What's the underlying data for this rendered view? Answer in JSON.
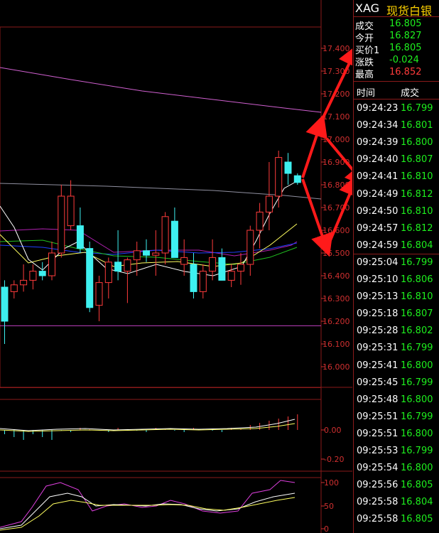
{
  "symbol": "XAG",
  "name": "现货白银",
  "quote": [
    {
      "label": "成交",
      "value": "16.805",
      "color": "#1ef01e"
    },
    {
      "label": "今开",
      "value": "16.827",
      "color": "#1ef01e"
    },
    {
      "label": "买价1",
      "value": "16.805",
      "color": "#1ef01e"
    },
    {
      "label": "涨跌",
      "value": "-0.024",
      "color": "#1ef01e"
    },
    {
      "label": "最高",
      "value": "16.852",
      "color": "#ff3b3b"
    }
  ],
  "ticks_header": {
    "time": "时间",
    "price": "成交"
  },
  "ticks": [
    {
      "time": "09:24:23",
      "price": "16.799"
    },
    {
      "time": "09:24:34",
      "price": "16.801"
    },
    {
      "time": "09:24:39",
      "price": "16.800"
    },
    {
      "time": "09:24:40",
      "price": "16.807"
    },
    {
      "time": "09:24:41",
      "price": "16.810"
    },
    {
      "time": "09:24:49",
      "price": "16.812"
    },
    {
      "time": "09:24:50",
      "price": "16.810"
    },
    {
      "time": "09:24:57",
      "price": "16.812"
    },
    {
      "time": "09:24:59",
      "price": "16.804"
    },
    {
      "time": "09:25:04",
      "price": "16.799"
    },
    {
      "time": "09:25:10",
      "price": "16.806"
    },
    {
      "time": "09:25:13",
      "price": "16.810"
    },
    {
      "time": "09:25:18",
      "price": "16.807"
    },
    {
      "time": "09:25:28",
      "price": "16.802"
    },
    {
      "time": "09:25:31",
      "price": "16.799"
    },
    {
      "time": "09:25:41",
      "price": "16.800"
    },
    {
      "time": "09:25:45",
      "price": "16.799"
    },
    {
      "time": "09:25:48",
      "price": "16.800"
    },
    {
      "time": "09:25:51",
      "price": "16.799"
    },
    {
      "time": "09:25:51",
      "price": "16.800"
    },
    {
      "time": "09:25:53",
      "price": "16.799"
    },
    {
      "time": "09:25:54",
      "price": "16.800"
    },
    {
      "time": "09:25:56",
      "price": "16.805"
    },
    {
      "time": "09:25:58",
      "price": "16.804"
    },
    {
      "time": "09:25:58",
      "price": "16.805"
    }
  ],
  "chart_data": [
    {
      "type": "candlestick",
      "ylim": [
        15.9,
        17.5
      ],
      "y_ticks": [
        "17.400",
        "17.300",
        "17.200",
        "17.100",
        "17.000",
        "16.900",
        "16.800",
        "16.700",
        "16.600",
        "16.500",
        "16.400",
        "16.300",
        "16.200",
        "16.100",
        "16.000"
      ],
      "candles": [
        {
          "o": 16.2,
          "h": 16.38,
          "l": 16.1,
          "c": 16.35,
          "up": false
        },
        {
          "o": 16.33,
          "h": 16.38,
          "l": 16.3,
          "c": 16.36,
          "up": true
        },
        {
          "o": 16.36,
          "h": 16.45,
          "l": 16.33,
          "c": 16.38,
          "up": true
        },
        {
          "o": 16.38,
          "h": 16.45,
          "l": 16.34,
          "c": 16.42,
          "up": true
        },
        {
          "o": 16.42,
          "h": 16.46,
          "l": 16.38,
          "c": 16.4,
          "up": false
        },
        {
          "o": 16.4,
          "h": 16.55,
          "l": 16.38,
          "c": 16.5,
          "up": true
        },
        {
          "o": 16.5,
          "h": 16.8,
          "l": 16.48,
          "c": 16.75,
          "up": true
        },
        {
          "o": 16.75,
          "h": 16.82,
          "l": 16.6,
          "c": 16.62,
          "up": true
        },
        {
          "o": 16.62,
          "h": 16.7,
          "l": 16.5,
          "c": 16.52,
          "up": false
        },
        {
          "o": 16.52,
          "h": 16.55,
          "l": 16.24,
          "c": 16.26,
          "up": false
        },
        {
          "o": 16.27,
          "h": 16.4,
          "l": 16.2,
          "c": 16.37,
          "up": true
        },
        {
          "o": 16.37,
          "h": 16.48,
          "l": 16.3,
          "c": 16.46,
          "up": true
        },
        {
          "o": 16.46,
          "h": 16.6,
          "l": 16.38,
          "c": 16.42,
          "up": false
        },
        {
          "o": 16.42,
          "h": 16.48,
          "l": 16.28,
          "c": 16.47,
          "up": true
        },
        {
          "o": 16.47,
          "h": 16.55,
          "l": 16.4,
          "c": 16.51,
          "up": true
        },
        {
          "o": 16.51,
          "h": 16.56,
          "l": 16.46,
          "c": 16.49,
          "up": false
        },
        {
          "o": 16.49,
          "h": 16.6,
          "l": 16.4,
          "c": 16.5,
          "up": true
        },
        {
          "o": 16.5,
          "h": 16.68,
          "l": 16.45,
          "c": 16.66,
          "up": true
        },
        {
          "o": 16.64,
          "h": 16.7,
          "l": 16.48,
          "c": 16.48,
          "up": false
        },
        {
          "o": 16.48,
          "h": 16.56,
          "l": 16.4,
          "c": 16.45,
          "up": true
        },
        {
          "o": 16.45,
          "h": 16.5,
          "l": 16.3,
          "c": 16.33,
          "up": false
        },
        {
          "o": 16.33,
          "h": 16.45,
          "l": 16.3,
          "c": 16.42,
          "up": true
        },
        {
          "o": 16.42,
          "h": 16.56,
          "l": 16.38,
          "c": 16.48,
          "up": true
        },
        {
          "o": 16.48,
          "h": 16.52,
          "l": 16.38,
          "c": 16.38,
          "up": false
        },
        {
          "o": 16.38,
          "h": 16.45,
          "l": 16.35,
          "c": 16.42,
          "up": true
        },
        {
          "o": 16.42,
          "h": 16.5,
          "l": 16.36,
          "c": 16.45,
          "up": true
        },
        {
          "o": 16.45,
          "h": 16.62,
          "l": 16.4,
          "c": 16.6,
          "up": true
        },
        {
          "o": 16.6,
          "h": 16.72,
          "l": 16.52,
          "c": 16.68,
          "up": true
        },
        {
          "o": 16.68,
          "h": 16.9,
          "l": 16.6,
          "c": 16.75,
          "up": true
        },
        {
          "o": 16.75,
          "h": 16.95,
          "l": 16.7,
          "c": 16.92,
          "up": true
        },
        {
          "o": 16.9,
          "h": 16.94,
          "l": 16.8,
          "c": 16.85,
          "up": false
        },
        {
          "o": 16.84,
          "h": 16.85,
          "l": 16.8,
          "c": 16.81,
          "up": false
        }
      ]
    },
    {
      "type": "line",
      "y_ticks": [
        "0.00",
        "-0.20"
      ]
    },
    {
      "type": "line",
      "y_ticks": [
        "100",
        "50",
        "0"
      ]
    }
  ]
}
